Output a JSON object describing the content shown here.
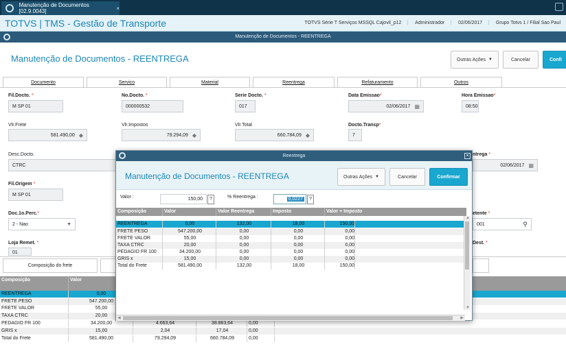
{
  "browser_tab": {
    "title": "Manutenção de Documentos [02.9.0043]",
    "close": "×"
  },
  "header": {
    "app_title": "TOTVS | TMS - Gestão de Transporte",
    "info": [
      "TOTVS Série T Serviços MSSQL Cajovil_p12",
      "Administrador",
      "02/06/2017",
      "Grupo Totvs 1 / Filial Sao Paul"
    ]
  },
  "window": {
    "title": "Manutenção de Documentos - REENTREGA"
  },
  "page": {
    "title": "Manutenção de Documentos - REENTREGA"
  },
  "toolbar": {
    "outras_acoes": "Outras Ações",
    "cancelar": "Cancelar",
    "confirmar": "Confi"
  },
  "form_tabs": [
    "Documento",
    "Servico",
    "Material",
    "Reentrega",
    "Refaturamento",
    "Outros"
  ],
  "fields": {
    "fil_docto": {
      "label": "Fil.Docto.",
      "value": "M SP 01"
    },
    "no_docto": {
      "label": "No.Docto.",
      "value": "000000532"
    },
    "serie_docto": {
      "label": "Serie Docto.",
      "value": "017"
    },
    "data_emissao": {
      "label": "Data Emissao",
      "value": "02/06/2017"
    },
    "hora_emissao": {
      "label": "Hora Emissao",
      "value": "08:50"
    },
    "vlr_frete": {
      "label": "Vlr.Frete",
      "value": "581.490,00"
    },
    "vlr_impostos": {
      "label": "Vlr.Impostos",
      "value": "79.294,09"
    },
    "vlr_total": {
      "label": "Vlr.Total",
      "value": "660.784,09"
    },
    "docto_transp": {
      "label": "Docto.Transp",
      "value": "7"
    },
    "desc_docto": {
      "label": "Desc.Docto.",
      "value": "CTRC"
    },
    "entrega": {
      "label": "ntrega",
      "value": "02/06/2017"
    },
    "fil_origem": {
      "label": "Fil.Origem",
      "value": "M SP 01"
    },
    "doc_perc": {
      "label": "Doc.1o.Perc.",
      "value": "2 - Nao"
    },
    "remetente": {
      "label": "etente",
      "value": "001"
    },
    "loja_remet": {
      "label": "Loja Remet.",
      "value": "01"
    },
    "dest": {
      "label": "Dest."
    }
  },
  "bottom_tabs": [
    "Composição do frete"
  ],
  "bottom_grid": {
    "headers": [
      "Composição",
      "Valor"
    ],
    "rows": [
      [
        "REENTREGA",
        "0,00",
        "",
        "",
        ""
      ],
      [
        "FRETE PESO",
        "547.200,00",
        "",
        "",
        ""
      ],
      [
        "FRETE VALOR",
        "55,00",
        "",
        "",
        ""
      ],
      [
        "TAXA CTRC",
        "20,00",
        "",
        "",
        ""
      ],
      [
        "PEDAGIO FR 100",
        "34.200,00",
        "4.663,64",
        "38.863,64",
        "0,00"
      ],
      [
        "GRIS x",
        "15,00",
        "2,04",
        "17,04",
        "0,00"
      ],
      [
        "Total do Frete",
        "581.490,00",
        "79.294,09",
        "660.784,09",
        "0,00"
      ]
    ]
  },
  "modal": {
    "bar_title": "Reentrega",
    "title": "Manutenção de Documentos - REENTREGA",
    "outras_acoes": "Outras Ações",
    "cancelar": "Cancelar",
    "confirmar": "Confirmar",
    "valor_label": "Valor :",
    "valor": "150,00",
    "pct_label": "% Reentrega :",
    "pct": "0,0227",
    "help": "?",
    "grid": {
      "headers": [
        "Composição",
        "Valor",
        "Valor Reentrega",
        "Imposto",
        "Valor + Imposto"
      ],
      "rows": [
        [
          "REENTREGA",
          "0,00",
          "132,00",
          "18,00",
          "150,00"
        ],
        [
          "FRETE PESO",
          "547.200,00",
          "0,00",
          "0,00",
          "0,00"
        ],
        [
          "FRETE VALOR",
          "55,00",
          "0,00",
          "0,00",
          "0,00"
        ],
        [
          "TAXA CTRC",
          "20,00",
          "0,00",
          "0,00",
          "0,00"
        ],
        [
          "PEDAGIO FR 100",
          "34.200,00",
          "0,00",
          "0,00",
          "0,00"
        ],
        [
          "GRIS x",
          "15,00",
          "0,00",
          "0,00",
          "0,00"
        ],
        [
          "Total do Frete",
          "581.490,00",
          "132,00",
          "18,00",
          "150,00"
        ]
      ]
    }
  },
  "colors": {
    "accent": "#19a7cf",
    "title_blue": "#1b86b7",
    "dark_bar": "#2b5a7a",
    "required": "#d62a2a"
  }
}
